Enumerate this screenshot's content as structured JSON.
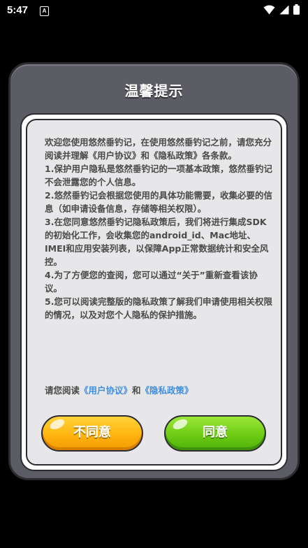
{
  "status_bar": {
    "time": "5:47",
    "notification_icon": "A",
    "icons": [
      "wifi-icon",
      "signal-icon",
      "battery-icon"
    ]
  },
  "dialog": {
    "title": "温馨提示",
    "paragraphs": [
      "欢迎您使用悠然垂钓记，在使用悠然垂钓记之前，请您充分阅读并理解《用户协议》和《隐私政策》各条款。",
      "1.保护用户隐私是悠然垂钓记的一项基本政策，悠然垂钓记不会泄露您的个人信息。",
      "2.悠然垂钓记会根据您使用的具体功能需要，收集必要的信息（如申请设备信息，存储等相关权限）。",
      "3.在您同意悠然垂钓记隐私政策后，我们将进行集成SDK的初始化工作，会收集您的android_id、Mac地址、IMEI和应用安装列表，以保障App正常数据统计和安全风控。",
      "4.为了方便您的查阅，您可以通过“关于”重新查看该协议。",
      "5.您可以阅读完整版的隐私政策了解我们申请使用相关权限的情况，以及对您个人隐私的保护措施。"
    ],
    "read_prefix": "请您阅读",
    "user_agreement_link": "《用户协议》",
    "read_and": "和",
    "privacy_policy_link": "《隐私政策》",
    "disagree_label": "不同意",
    "agree_label": "同意"
  },
  "colors": {
    "background": "#000000",
    "dialog_frame": "#5c5d64",
    "panel": "#e7e7e9",
    "link": "#3f8ede",
    "disagree_button": "#ffb40e",
    "agree_button": "#6dcc13"
  }
}
